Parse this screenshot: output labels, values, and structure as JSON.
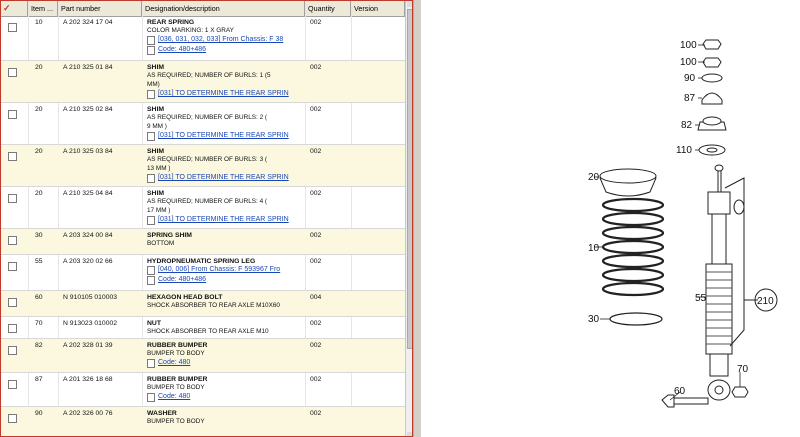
{
  "columns": {
    "check": "✓",
    "item": "Item ...",
    "part_number": "Part number",
    "designation": "Designation/description",
    "quantity": "Quantity",
    "version": "Version"
  },
  "rows": [
    {
      "item": "10",
      "part": "A 202 324 17 04",
      "title": "REAR SPRING",
      "lines": [
        "COLOR MARKING: 1 X GRAY"
      ],
      "links": [
        "[036, 031, 032, 033] From Chassis: F 38",
        "Code: 480+486"
      ],
      "qty": "002"
    },
    {
      "item": "20",
      "part": "A 210 325 01 84",
      "title": "SHIM",
      "lines": [
        "AS REQUIRED; NUMBER OF BURLS: 1 (5",
        "MM)"
      ],
      "links": [
        "[031] TO DETERMINE THE REAR SPRIN"
      ],
      "qty": "002"
    },
    {
      "item": "20",
      "part": "A 210 325 02 84",
      "title": "SHIM",
      "lines": [
        "AS REQUIRED; NUMBER OF BURLS: 2 (",
        "9 MM )"
      ],
      "links": [
        "[031] TO DETERMINE THE REAR SPRIN"
      ],
      "qty": "002"
    },
    {
      "item": "20",
      "part": "A 210 325 03 84",
      "title": "SHIM",
      "lines": [
        "AS REQUIRED; NUMBER OF BURLS: 3 (",
        "13 MM )"
      ],
      "links": [
        "[031] TO DETERMINE THE REAR SPRIN"
      ],
      "qty": "002"
    },
    {
      "item": "20",
      "part": "A 210 325 04 84",
      "title": "SHIM",
      "lines": [
        "AS REQUIRED; NUMBER OF BURLS: 4 (",
        "17 MM )"
      ],
      "links": [
        "[031] TO DETERMINE THE REAR SPRIN"
      ],
      "qty": "002"
    },
    {
      "item": "30",
      "part": "A 203 324 00 84",
      "title": "SPRING SHIM",
      "lines": [
        "BOTTOM"
      ],
      "links": [],
      "qty": "002"
    },
    {
      "item": "55",
      "part": "A 203 320 02 66",
      "title": "HYDROPNEUMATIC SPRING LEG",
      "lines": [],
      "links": [
        "[040, 006] From Chassis: F 593967 Fro",
        "Code: 480+486"
      ],
      "qty": "002"
    },
    {
      "item": "60",
      "part": "N 910105 010003",
      "title": "HEXAGON HEAD BOLT",
      "lines": [
        "SHOCK ABSORBER TO REAR AXLE M10X60"
      ],
      "links": [],
      "qty": "004"
    },
    {
      "item": "70",
      "part": "N 913023 010002",
      "title": "NUT",
      "lines": [
        "SHOCK ABSORBER TO REAR AXLE M10"
      ],
      "links": [],
      "qty": "002"
    },
    {
      "item": "82",
      "part": "A 202 328 01 39",
      "title": "RUBBER BUMPER",
      "lines": [
        "BUMPER TO BODY"
      ],
      "links": [
        "Code: 480"
      ],
      "qty": "002"
    },
    {
      "item": "87",
      "part": "A 201 326 18 68",
      "title": "RUBBER BUMPER",
      "lines": [
        "BUMPER TO BODY"
      ],
      "links": [
        "Code: 480"
      ],
      "qty": "002"
    },
    {
      "item": "90",
      "part": "A 202 326 00 76",
      "title": "WASHER",
      "lines": [
        "BUMPER TO BODY"
      ],
      "links": [],
      "qty": "002"
    }
  ],
  "diagram": {
    "callouts": [
      "100",
      "100",
      "90",
      "87",
      "82",
      "110",
      "20",
      "10",
      "30",
      "55",
      "60",
      "70",
      "210"
    ]
  }
}
